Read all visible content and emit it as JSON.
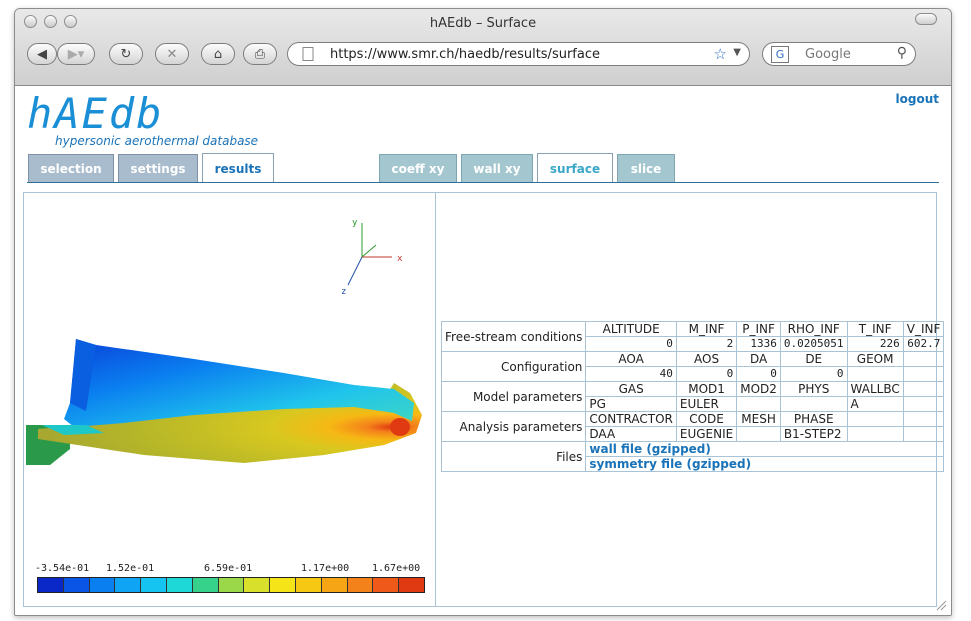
{
  "window": {
    "title": "hAEdb – Surface"
  },
  "toolbar": {
    "url": "https://www.smr.ch/haedb/results/surface",
    "search_placeholder": "Google"
  },
  "site": {
    "logo": "hAEdb",
    "tagline": "hypersonic aerothermal database",
    "logout": "logout"
  },
  "tabs_main": [
    {
      "label": "selection",
      "active": false
    },
    {
      "label": "settings",
      "active": false
    },
    {
      "label": "results",
      "active": true
    }
  ],
  "tabs_view": [
    {
      "label": "coeff xy",
      "active": false
    },
    {
      "label": "wall xy",
      "active": false
    },
    {
      "label": "surface",
      "active": true
    },
    {
      "label": "slice",
      "active": false
    }
  ],
  "axes": {
    "x": "x",
    "y": "y",
    "z": "z"
  },
  "colorbar": {
    "labels": [
      "-3.54e-01",
      "1.52e-01",
      "6.59e-01",
      "1.17e+00",
      "1.67e+00"
    ],
    "colors": [
      "#0a28c8",
      "#0b55e6",
      "#0a7ff0",
      "#10a4f4",
      "#16c4f2",
      "#1ed8d8",
      "#36d28c",
      "#9ad84a",
      "#d8e02c",
      "#f4e418",
      "#f6c814",
      "#f6a614",
      "#f4821a",
      "#ef5a1a",
      "#e03a12"
    ]
  },
  "params": {
    "freestream": {
      "label": "Free-stream conditions",
      "headers": [
        "ALTITUDE",
        "M_INF",
        "P_INF",
        "RHO_INF",
        "T_INF",
        "V_INF"
      ],
      "values": [
        "0",
        "2",
        "1336",
        "0.0205051",
        "226",
        "602.7"
      ]
    },
    "configuration": {
      "label": "Configuration",
      "headers": [
        "AOA",
        "AOS",
        "DA",
        "DE",
        "GEOM",
        ""
      ],
      "values": [
        "40",
        "0",
        "0",
        "0",
        "",
        ""
      ]
    },
    "model": {
      "label": "Model parameters",
      "headers": [
        "GAS",
        "MOD1",
        "MOD2",
        "PHYS",
        "WALLBC",
        ""
      ],
      "values": [
        "PG",
        "EULER",
        "",
        "",
        "A",
        ""
      ]
    },
    "analysis": {
      "label": "Analysis parameters",
      "headers": [
        "CONTRACTOR",
        "CODE",
        "MESH",
        "PHASE",
        "",
        ""
      ],
      "values": [
        "DAA",
        "EUGENIE",
        "",
        "B1-STEP2",
        "",
        ""
      ]
    },
    "files": {
      "label": "Files",
      "links": [
        "wall file (gzipped)",
        "symmetry file (gzipped)"
      ]
    }
  }
}
